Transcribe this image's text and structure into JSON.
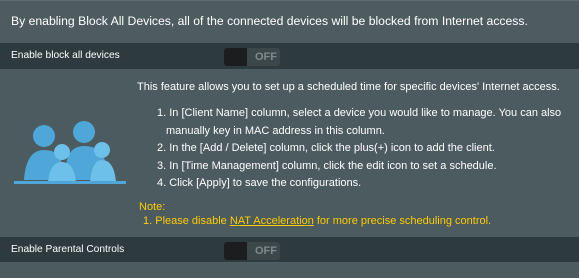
{
  "intro": {
    "text": "By enabling Block All Devices, all of the connected devices will be blocked from Internet access."
  },
  "block_all": {
    "label": "Enable block all devices",
    "toggle_state": "OFF"
  },
  "info": {
    "icon": "family-icon",
    "feature_text": "This feature allows you to set up a scheduled time for specific devices' Internet access.",
    "steps": [
      "1. In [Client Name] column, select a device you would like to manage. You can also",
      "manually key in MAC address in this column.",
      "2. In the [Add / Delete] column, click the plus(+) icon to add the client.",
      "3. In [Time Management] column, click the edit icon to set a schedule.",
      "4. Click [Apply] to save the configurations."
    ],
    "note_heading": "Note:",
    "note_prefix": "1. Please disable ",
    "note_link": "NAT Acceleration",
    "note_suffix": " for more precise scheduling control."
  },
  "parental": {
    "label": "Enable Parental Controls",
    "toggle_state": "OFF"
  },
  "colors": {
    "background": "#4b5b5f",
    "row_background": "#2d3a3e",
    "note_color": "#ffcc00",
    "icon_color": "#4ea7d8"
  }
}
